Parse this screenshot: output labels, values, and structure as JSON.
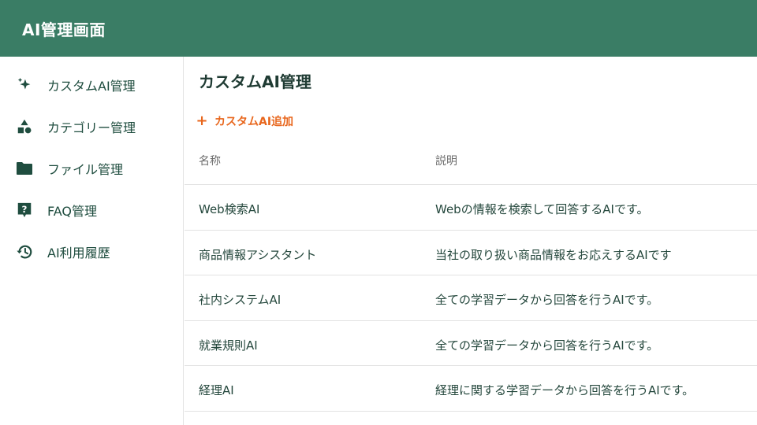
{
  "app": {
    "title": "AI管理画面"
  },
  "sidebar": {
    "items": [
      {
        "label": "カスタムAI管理",
        "icon": "sparkle-icon"
      },
      {
        "label": "カテゴリー管理",
        "icon": "shapes-icon"
      },
      {
        "label": "ファイル管理",
        "icon": "folder-icon"
      },
      {
        "label": "FAQ管理",
        "icon": "help-box-icon"
      },
      {
        "label": "AI利用履歴",
        "icon": "history-icon"
      }
    ]
  },
  "main": {
    "title": "カスタムAI管理",
    "add_button": "カスタムAI追加",
    "columns": [
      "名称",
      "説明"
    ],
    "rows": [
      {
        "name": "Web検索AI",
        "description": "Webの情報を検索して回答するAIです。"
      },
      {
        "name": "商品情報アシスタント",
        "description": "当社の取り扱い商品情報をお応えするAIです"
      },
      {
        "name": "社内システムAI",
        "description": "全ての学習データから回答を行うAIです。"
      },
      {
        "name": "就業規則AI",
        "description": "全ての学習データから回答を行うAIです。"
      },
      {
        "name": "経理AI",
        "description": "経理に関する学習データから回答を行うAIです。"
      }
    ]
  },
  "colors": {
    "header": "#3a7d65",
    "accent": "#e8661c",
    "nav_text": "#1f4d3f",
    "icon": "#1f4d3f"
  }
}
